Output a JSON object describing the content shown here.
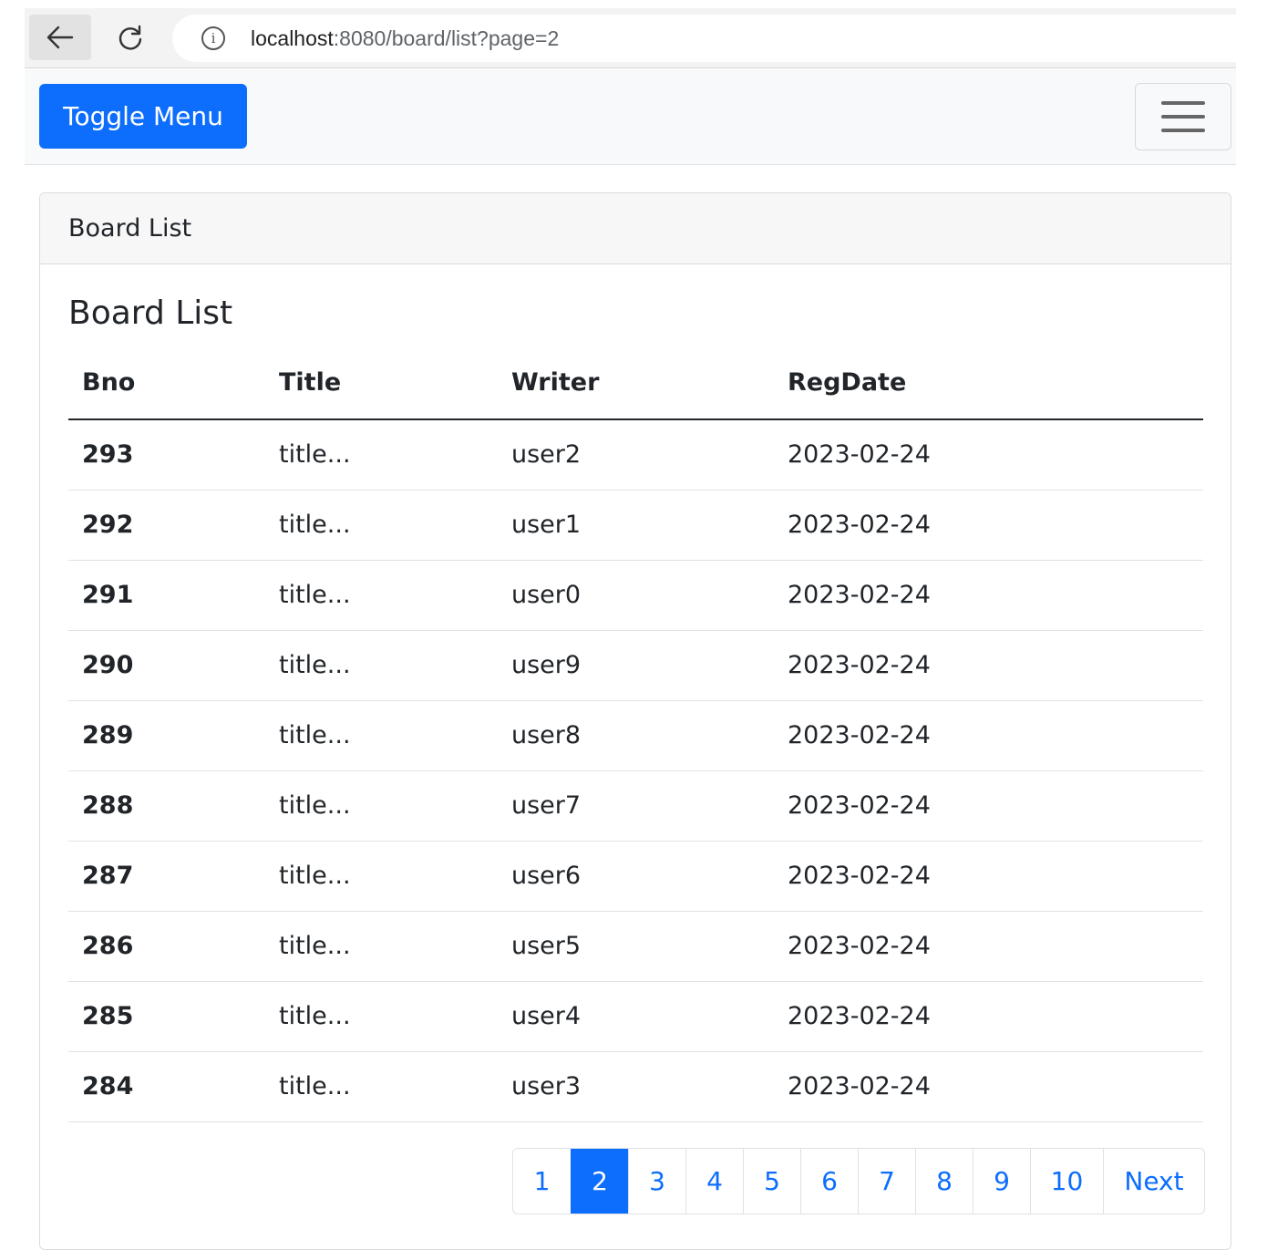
{
  "browser": {
    "url_host": "localhost",
    "url_rest": ":8080/board/list?page=2"
  },
  "navbar": {
    "toggle_label": "Toggle Menu"
  },
  "card": {
    "header": "Board List",
    "title": "Board List",
    "columns": [
      "Bno",
      "Title",
      "Writer",
      "RegDate"
    ],
    "rows": [
      {
        "bno": "293",
        "title": "title...",
        "writer": "user2",
        "regdate": "2023-02-24"
      },
      {
        "bno": "292",
        "title": "title...",
        "writer": "user1",
        "regdate": "2023-02-24"
      },
      {
        "bno": "291",
        "title": "title...",
        "writer": "user0",
        "regdate": "2023-02-24"
      },
      {
        "bno": "290",
        "title": "title...",
        "writer": "user9",
        "regdate": "2023-02-24"
      },
      {
        "bno": "289",
        "title": "title...",
        "writer": "user8",
        "regdate": "2023-02-24"
      },
      {
        "bno": "288",
        "title": "title...",
        "writer": "user7",
        "regdate": "2023-02-24"
      },
      {
        "bno": "287",
        "title": "title...",
        "writer": "user6",
        "regdate": "2023-02-24"
      },
      {
        "bno": "286",
        "title": "title...",
        "writer": "user5",
        "regdate": "2023-02-24"
      },
      {
        "bno": "285",
        "title": "title...",
        "writer": "user4",
        "regdate": "2023-02-24"
      },
      {
        "bno": "284",
        "title": "title...",
        "writer": "user3",
        "regdate": "2023-02-24"
      }
    ]
  },
  "pagination": {
    "pages": [
      "1",
      "2",
      "3",
      "4",
      "5",
      "6",
      "7",
      "8",
      "9",
      "10"
    ],
    "active": "2",
    "next_label": "Next"
  }
}
